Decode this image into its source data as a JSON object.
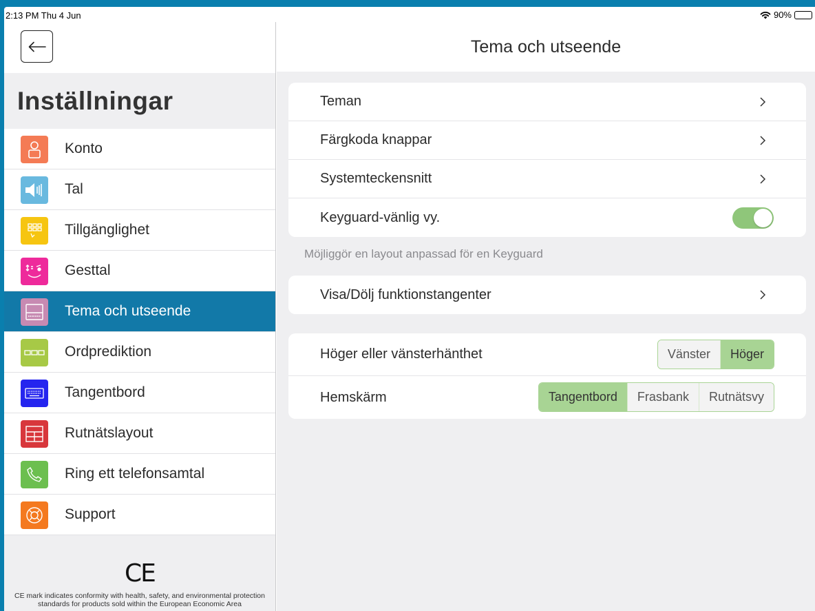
{
  "status_bar": {
    "time": "2:13 PM  Thu 4 Jun",
    "battery": "90%"
  },
  "sidebar": {
    "title": "Inställningar",
    "items": [
      {
        "label": "Konto",
        "icon": "person-icon",
        "color": "#f47b55"
      },
      {
        "label": "Tal",
        "icon": "speaker-icon",
        "color": "#69b9df"
      },
      {
        "label": "Tillgänglighet",
        "icon": "accessibility-grid-icon",
        "color": "#f6c511"
      },
      {
        "label": "Gesttal",
        "icon": "gesture-face-icon",
        "color": "#ee2a9b"
      },
      {
        "label": "Tema och utseende",
        "icon": "theme-icon",
        "color": "#c78ab2",
        "active": true
      },
      {
        "label": "Ordprediktion",
        "icon": "word-prediction-icon",
        "color": "#a7c946"
      },
      {
        "label": "Tangentbord",
        "icon": "keyboard-icon",
        "color": "#2525ef"
      },
      {
        "label": "Rutnätslayout",
        "icon": "grid-layout-icon",
        "color": "#d8373c"
      },
      {
        "label": "Ring ett telefonsamtal",
        "icon": "phone-icon",
        "color": "#6cbf4f"
      },
      {
        "label": "Support",
        "icon": "lifebuoy-icon",
        "color": "#f4791f"
      }
    ],
    "ce_mark": "CE",
    "ce_text": "CE mark indicates conformity with health, safety, and environmental protection standards for products sold within the European Economic Area"
  },
  "main": {
    "title": "Tema och utseende",
    "group1": {
      "rows": [
        {
          "label": "Teman"
        },
        {
          "label": "Färgkoda knappar"
        },
        {
          "label": "Systemteckensnitt"
        },
        {
          "label": "Keyguard-vänlig vy.",
          "toggle_on": true
        }
      ],
      "footnote": "Möjliggör en layout anpassad för en Keyguard"
    },
    "group2": {
      "label": "Visa/Dölj funktionstangenter"
    },
    "group3": {
      "handedness_label": "Höger eller vänsterhänthet",
      "handedness_options": [
        "Vänster",
        "Höger"
      ],
      "handedness_selected": "Höger",
      "home_label": "Hemskärm",
      "home_options": [
        "Tangentbord",
        "Frasbank",
        "Rutnätsvy"
      ],
      "home_selected": "Tangentbord"
    }
  },
  "colors": {
    "accent": "#1279a8",
    "toggle_green": "#8fc67a",
    "segment_green": "#a8d494",
    "frame_blue": "#0a7fae"
  }
}
